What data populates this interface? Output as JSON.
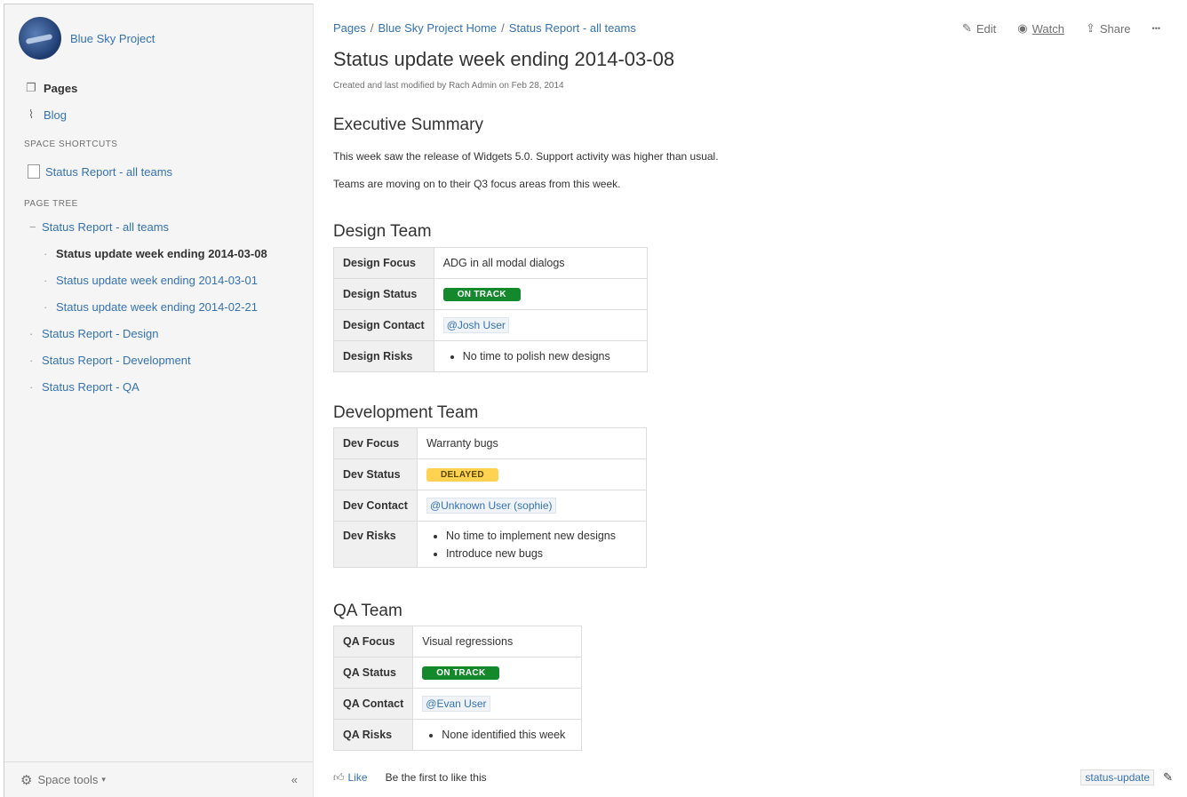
{
  "sidebar": {
    "space_name": "Blue Sky Project",
    "nav": [
      {
        "label": "Pages",
        "icon": "pages-icon"
      },
      {
        "label": "Blog",
        "icon": "rss-icon"
      }
    ],
    "shortcuts_heading": "SPACE SHORTCUTS",
    "shortcut": "Status Report - all teams",
    "tree_heading": "PAGE TREE",
    "tree": [
      {
        "label": "Status Report - all teams",
        "bullet": "−"
      },
      {
        "label": "Status update week ending 2014-03-08",
        "bullet": "·"
      },
      {
        "label": "Status update week ending 2014-03-01",
        "bullet": "·"
      },
      {
        "label": "Status update week ending 2014-02-21",
        "bullet": "·"
      },
      {
        "label": "Status Report - Design",
        "bullet": "·"
      },
      {
        "label": "Status Report - Development",
        "bullet": "·"
      },
      {
        "label": "Status Report - QA",
        "bullet": "·"
      }
    ],
    "space_tools": "Space tools",
    "collapse": "«"
  },
  "breadcrumbs": [
    "Pages",
    "Blue Sky Project Home",
    "Status Report - all teams"
  ],
  "actions": {
    "edit": "Edit",
    "watch": "Watch",
    "share": "Share",
    "more": "•••"
  },
  "page": {
    "title": "Status update week ending 2014-03-08",
    "meta": "Created and last modified by Rach Admin on Feb 28, 2014",
    "exec_heading": "Executive Summary",
    "exec_p1": "This week saw the release of Widgets 5.0.  Support activity was higher than usual.",
    "exec_p2": "Teams are moving on to their Q3 focus areas from this week."
  },
  "design": {
    "heading": "Design Team",
    "focus_label": "Design Focus",
    "focus": "ADG in all modal dialogs",
    "status_label": "Design Status",
    "status": "ON TRACK",
    "contact_label": "Design Contact",
    "contact": "@Josh User",
    "risks_label": "Design Risks",
    "risks": [
      "No time to polish new designs"
    ]
  },
  "dev": {
    "heading": "Development Team",
    "focus_label": "Dev Focus",
    "focus": "Warranty bugs",
    "status_label": "Dev Status",
    "status": "DELAYED",
    "contact_label": "Dev Contact",
    "contact": "@Unknown User (sophie)",
    "risks_label": "Dev Risks",
    "risks": [
      "No time to implement new designs",
      "Introduce new bugs"
    ]
  },
  "qa": {
    "heading": "QA Team",
    "focus_label": "QA Focus",
    "focus": "Visual regressions",
    "status_label": "QA Status",
    "status": "ON TRACK",
    "contact_label": "QA Contact",
    "contact": "@Evan User",
    "risks_label": "QA Risks",
    "risks": [
      "None identified this week"
    ]
  },
  "footer": {
    "like": "Like",
    "first_like": "Be the first to like this",
    "label": "status-update"
  },
  "colors": {
    "link": "#3572b0",
    "on_track": "#14892c",
    "delayed": "#ffd351"
  }
}
